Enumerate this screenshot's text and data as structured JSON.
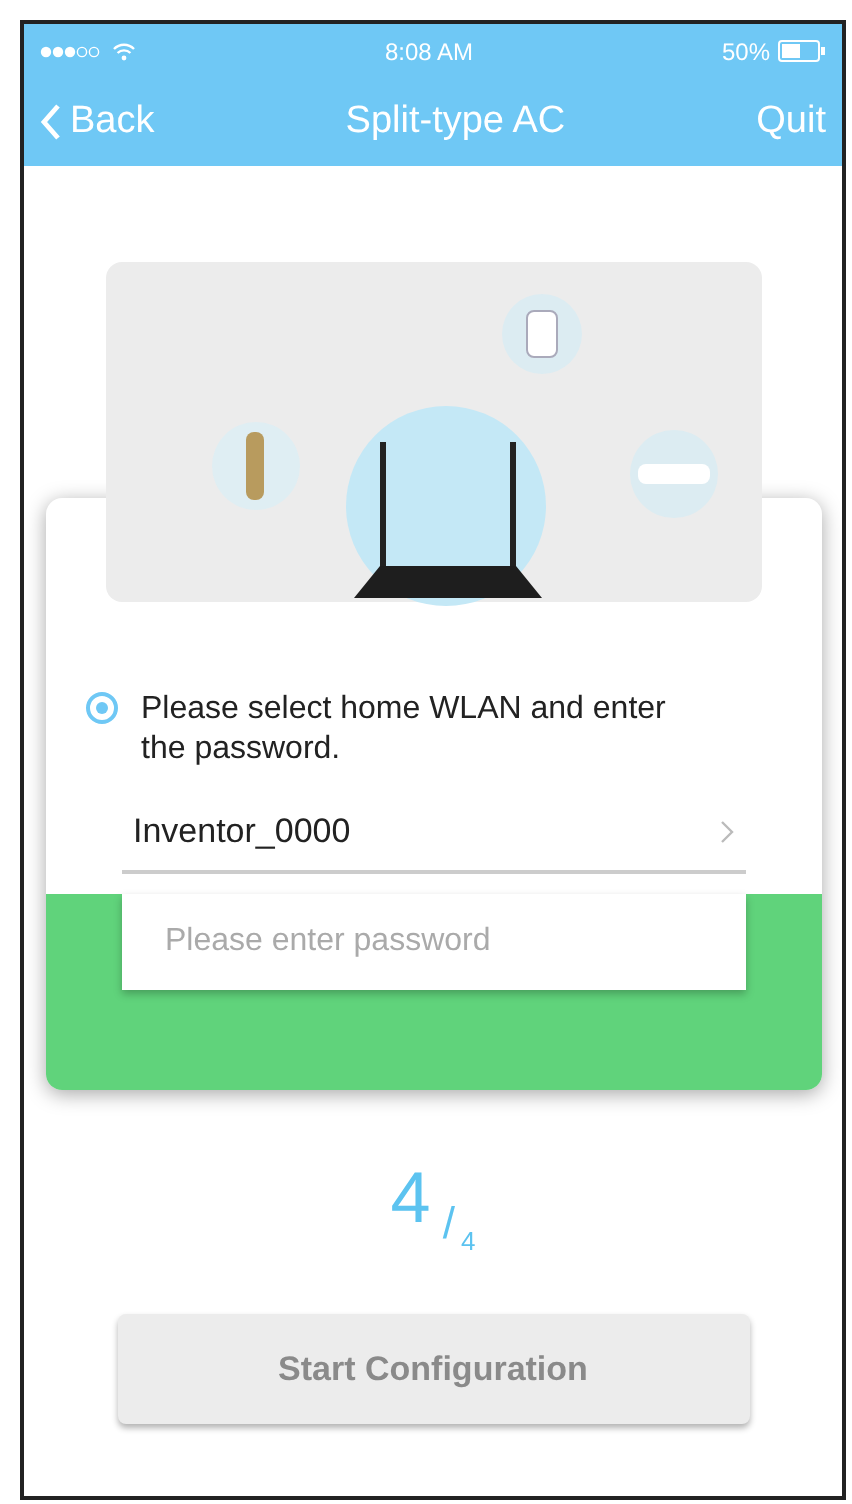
{
  "status_bar": {
    "time": "8:08 AM",
    "battery": "50%"
  },
  "nav_bar": {
    "back": "Back",
    "title": "Split-type AC",
    "action": "Quit"
  },
  "prompt": {
    "text": "Please select home WLAN and enter the password.",
    "selected": true
  },
  "network_field": {
    "value": "Inventor_0000"
  },
  "password_field": {
    "placeholder": "Please enter password"
  },
  "step": {
    "current": "4",
    "separator": "/",
    "total": "4"
  },
  "start_button": {
    "label": "Start Configuration",
    "disabled": true
  }
}
